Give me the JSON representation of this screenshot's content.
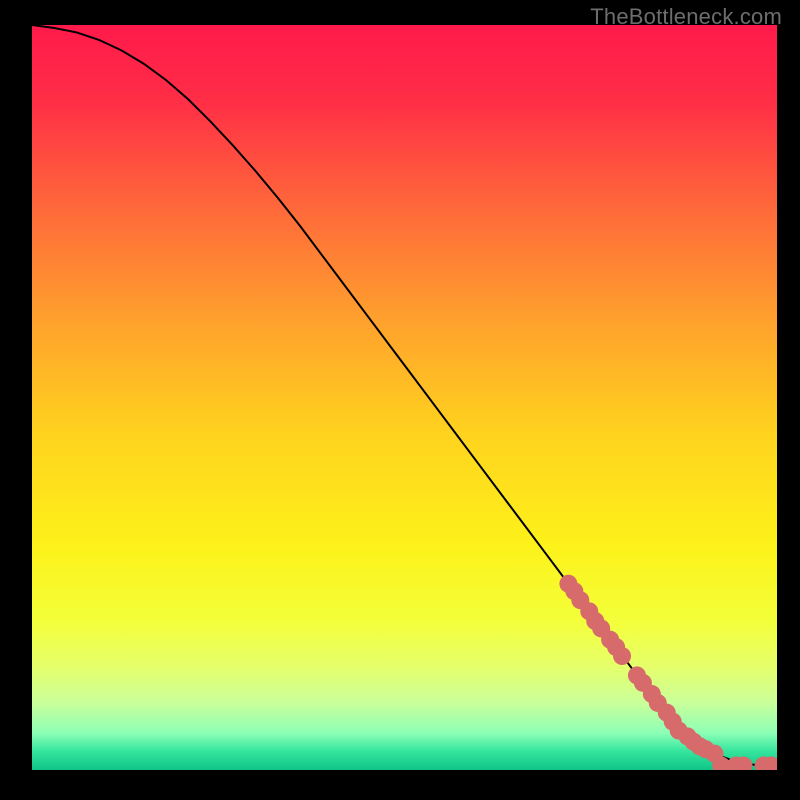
{
  "watermark": "TheBottleneck.com",
  "chart_data": {
    "type": "line",
    "title": "",
    "xlabel": "",
    "ylabel": "",
    "xlim": [
      0,
      100
    ],
    "ylim": [
      0,
      100
    ],
    "grid": false,
    "legend": false,
    "series": [
      {
        "name": "curve",
        "kind": "line",
        "color": "#000000",
        "x": [
          0,
          3,
          6,
          9,
          12,
          15,
          18,
          21,
          24,
          27,
          30,
          33,
          36,
          39,
          42,
          45,
          48,
          51,
          54,
          57,
          60,
          63,
          66,
          69,
          72,
          75,
          78,
          81,
          84,
          86,
          88,
          90,
          92,
          94,
          96,
          98,
          100
        ],
        "y": [
          100,
          99.6,
          99.0,
          98.0,
          96.6,
          94.8,
          92.6,
          90.0,
          87.0,
          83.8,
          80.4,
          76.8,
          73.0,
          69.0,
          65.0,
          61.0,
          57.0,
          53.0,
          49.0,
          45.0,
          41.0,
          37.0,
          33.0,
          29.0,
          25.0,
          21.0,
          17.0,
          13.0,
          9.0,
          6.5,
          4.5,
          3.0,
          2.0,
          1.3,
          0.8,
          0.6,
          0.6
        ]
      },
      {
        "name": "markers",
        "kind": "scatter",
        "color": "#d76a6a",
        "radius_px": 9,
        "x": [
          72.0,
          72.8,
          73.6,
          74.8,
          75.6,
          76.4,
          77.6,
          78.4,
          79.2,
          81.2,
          82.0,
          83.2,
          84.0,
          85.2,
          86.0,
          86.8,
          88.0,
          88.8,
          89.6,
          90.4,
          91.6,
          92.5,
          94.5,
          95.5,
          98.2,
          99.2
        ],
        "y": [
          25.0,
          24.0,
          22.8,
          21.3,
          20.0,
          19.0,
          17.5,
          16.5,
          15.3,
          12.7,
          11.7,
          10.2,
          9.0,
          7.7,
          6.5,
          5.3,
          4.5,
          3.8,
          3.2,
          2.8,
          2.2,
          0.6,
          0.6,
          0.6,
          0.6,
          0.6
        ]
      }
    ],
    "background_gradient": {
      "stops": [
        {
          "offset": 0.0,
          "color": "#ff1a4b"
        },
        {
          "offset": 0.1,
          "color": "#ff2d46"
        },
        {
          "offset": 0.25,
          "color": "#ff6a3a"
        },
        {
          "offset": 0.4,
          "color": "#ffa22c"
        },
        {
          "offset": 0.55,
          "color": "#ffd31e"
        },
        {
          "offset": 0.7,
          "color": "#fdf21a"
        },
        {
          "offset": 0.8,
          "color": "#f3ff3a"
        },
        {
          "offset": 0.86,
          "color": "#e6ff6a"
        },
        {
          "offset": 0.91,
          "color": "#c9ff9a"
        },
        {
          "offset": 0.95,
          "color": "#8dffb6"
        },
        {
          "offset": 0.975,
          "color": "#35e59d"
        },
        {
          "offset": 1.0,
          "color": "#0fc487"
        }
      ]
    }
  }
}
